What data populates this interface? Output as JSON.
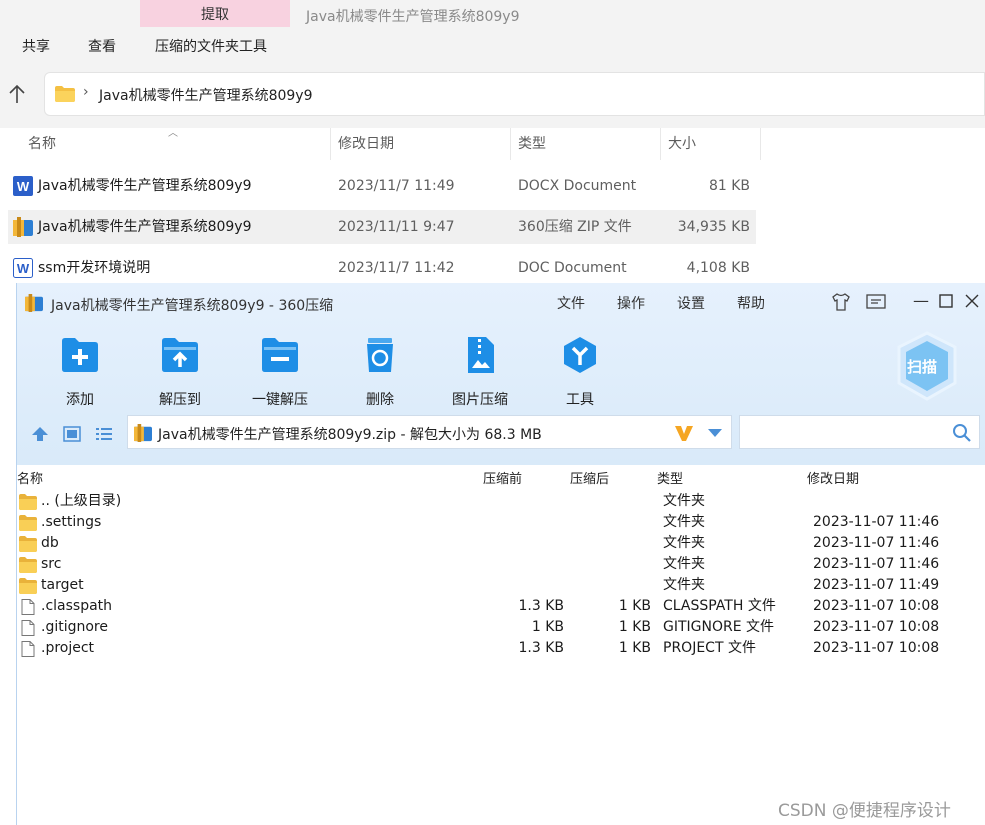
{
  "explorer": {
    "extract_tab": "提取",
    "window_title": "Java机械零件生产管理系统809y9",
    "ribbon_tabs": [
      "共享",
      "查看",
      "压缩的文件夹工具"
    ],
    "address_path": "Java机械零件生产管理系统809y9",
    "columns": [
      "名称",
      "修改日期",
      "类型",
      "大小"
    ],
    "files": [
      {
        "name": "Java机械零件生产管理系统809y9",
        "date": "2023/11/7 11:49",
        "type": "DOCX Document",
        "size": "81 KB",
        "icon": "word-doc-icon"
      },
      {
        "name": "Java机械零件生产管理系统809y9",
        "date": "2023/11/11 9:47",
        "type": "360压缩 ZIP 文件",
        "size": "34,935 KB",
        "icon": "zip-archive-icon"
      },
      {
        "name": "ssm开发环境说明",
        "date": "2023/11/7 11:42",
        "type": "DOC Document",
        "size": "4,108 KB",
        "icon": "word-doc-outline-icon"
      }
    ]
  },
  "zip": {
    "title": "Java机械零件生产管理系统809y9 - 360压缩",
    "menu": [
      "文件",
      "操作",
      "设置",
      "帮助"
    ],
    "tools": [
      "添加",
      "解压到",
      "一键解压",
      "删除",
      "图片压缩",
      "工具"
    ],
    "scan_label": "扫描",
    "path_text": "Java机械零件生产管理系统809y9.zip - 解包大小为 68.3 MB",
    "columns": [
      "名称",
      "压缩前",
      "压缩后",
      "类型",
      "修改日期"
    ],
    "rows": [
      {
        "name": ".. (上级目录)",
        "before": "",
        "after": "",
        "type": "文件夹",
        "date": "",
        "icon": "folder"
      },
      {
        "name": ".settings",
        "before": "",
        "after": "",
        "type": "文件夹",
        "date": "2023-11-07 11:46",
        "icon": "folder"
      },
      {
        "name": "db",
        "before": "",
        "after": "",
        "type": "文件夹",
        "date": "2023-11-07 11:46",
        "icon": "folder"
      },
      {
        "name": "src",
        "before": "",
        "after": "",
        "type": "文件夹",
        "date": "2023-11-07 11:46",
        "icon": "folder"
      },
      {
        "name": "target",
        "before": "",
        "after": "",
        "type": "文件夹",
        "date": "2023-11-07 11:49",
        "icon": "folder"
      },
      {
        "name": ".classpath",
        "before": "1.3 KB",
        "after": "1 KB",
        "type": "CLASSPATH 文件",
        "date": "2023-11-07 10:08",
        "icon": "file"
      },
      {
        "name": ".gitignore",
        "before": "1 KB",
        "after": "1 KB",
        "type": "GITIGNORE 文件",
        "date": "2023-11-07 10:08",
        "icon": "file"
      },
      {
        "name": ".project",
        "before": "1.3 KB",
        "after": "1 KB",
        "type": "PROJECT 文件",
        "date": "2023-11-07 10:08",
        "icon": "file"
      }
    ]
  },
  "watermark": "CSDN @便捷程序设计",
  "colors": {
    "accent_blue": "#1e8ee6",
    "extract_tab_bg": "#f8d2e0",
    "zip_header_bg": "#e6f1fd",
    "word_blue": "#2b5fc9"
  }
}
